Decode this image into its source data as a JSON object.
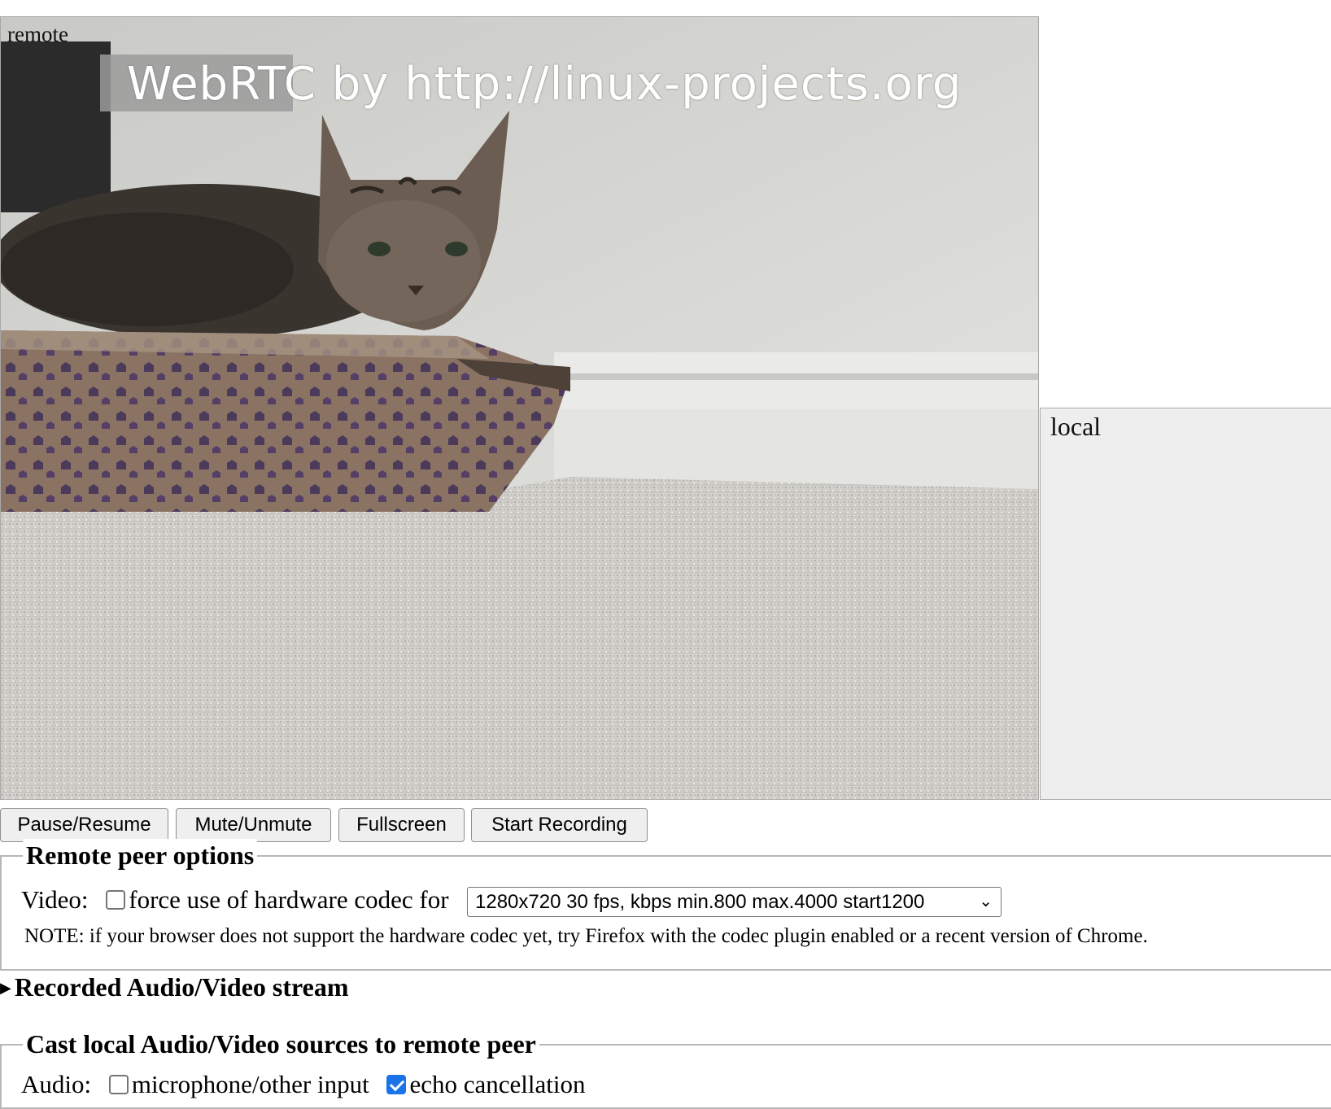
{
  "videos": {
    "remote_label": "remote",
    "local_label": "local",
    "overlay_text": "WebRTC by http://linux-projects.org"
  },
  "buttons": {
    "pause_resume": "Pause/Resume",
    "mute_unmute": "Mute/Unmute",
    "fullscreen": "Fullscreen",
    "start_recording": "Start Recording"
  },
  "remote_options": {
    "legend": "Remote peer options",
    "video_label": "Video:",
    "hw_codec_label": "force use of hardware codec for",
    "hw_codec_checked": false,
    "resolution_selected": "1280x720 30 fps, kbps min.800 max.4000 start1200",
    "note": "NOTE: if your browser does not support the hardware codec yet, try Firefox with the codec plugin enabled or a recent version of Chrome."
  },
  "recorded": {
    "summary": "Recorded Audio/Video stream"
  },
  "cast_local": {
    "legend": "Cast local Audio/Video sources to remote peer",
    "audio_label": "Audio:",
    "microphone_label": "microphone/other input",
    "microphone_checked": false,
    "echo_label": "echo cancellation",
    "echo_checked": true
  }
}
